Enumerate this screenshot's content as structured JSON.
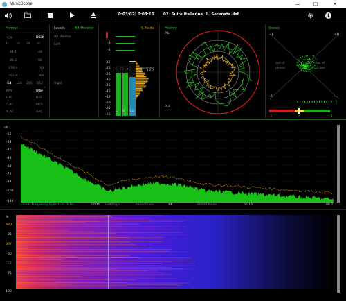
{
  "window": {
    "title": "MusicScope",
    "minimize": "—",
    "maximize": "☐",
    "close": "✕"
  },
  "toolbar": {
    "time_elapsed": "0:03:02",
    "time_total": "0:03:16",
    "track": "02. Suite Italienne. II. Serenata.dsf"
  },
  "format": {
    "title": "Format",
    "pcm": "PCM",
    "dsd": "DSD",
    "pcm_rates": [
      "1",
      "16",
      "24",
      "32"
    ],
    "rows_left": [
      "44.1",
      "88.2",
      "176.4",
      "352.8"
    ],
    "rows_right": [
      "48",
      "96",
      "192",
      "384"
    ],
    "dsd_rates": [
      "64",
      "128",
      "256",
      "512"
    ],
    "formats_left": [
      "WAV",
      "AIFF",
      "FLAC",
      "ALAC"
    ],
    "formats_right": [
      "DSF",
      "DFF",
      "MP3",
      "AAC"
    ]
  },
  "levels": {
    "title": "Levels",
    "mode": "Bit Monitor",
    "bit_monitor": "Bit Monitor",
    "left": "Left",
    "right": "Right",
    "s_mode": "S-Mode",
    "scale_top": [
      "-3",
      "-6"
    ],
    "scale": [
      "-12",
      "-20",
      "-25",
      "-30",
      "-35",
      "-40",
      "-45",
      "-50",
      "-55",
      "-60"
    ],
    "meter_labels": [
      "L",
      "R",
      "LU"
    ],
    "peak_value": "13.7"
  },
  "history": {
    "title": "History",
    "pil": "PIL",
    "plr": "PLR"
  },
  "stereo": {
    "title": "Stereo",
    "plus_l": "+L",
    "plus_r": "+R",
    "minus_r": "-R",
    "minus_l": "-L",
    "out_of_phase": "out of phase",
    "corr_labels": [
      "-1",
      "0",
      "+1"
    ]
  },
  "spectrum": {
    "db_label": "dB",
    "y_ticks": [
      "-12",
      "-24",
      "-36",
      "-48",
      "-60",
      "-72",
      "-84",
      "-100",
      "-144"
    ],
    "status": "Linear Frequency Spectrum (kHz)",
    "x_ticks": [
      "22.05",
      "44.1",
      "66.15",
      "88.2"
    ],
    "mode_left_right": "Left/Right",
    "mode_pano": "Pano/Phase",
    "mode_20000": "-20000 Mode"
  },
  "spectrogram": {
    "pct": "%",
    "labels": [
      "MAX",
      "25",
      "BRY",
      "50",
      "CGF",
      "75",
      "100"
    ]
  },
  "colors": {
    "accent_green": "#26c626",
    "accent_orange": "#e6a418",
    "meter_blue": "#1f8ab8",
    "meter_green": "#1fb11f"
  }
}
